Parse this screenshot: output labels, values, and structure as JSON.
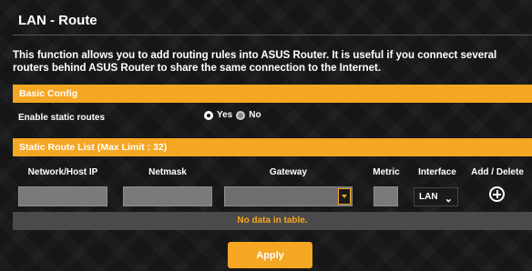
{
  "header": {
    "title": "LAN - Route",
    "description": "This function allows you to add routing rules into ASUS Router. It is useful if you connect several routers behind ASUS Router to share the same connection to the Internet."
  },
  "basic_config": {
    "section_title": "Basic Config",
    "static_routes_label": "Enable static routes",
    "yes_label": "Yes",
    "no_label": "No",
    "selected": "Yes"
  },
  "static_route_list": {
    "section_title": "Static Route List (Max Limit : 32)",
    "columns": [
      "Network/Host IP",
      "Netmask",
      "Gateway",
      "Metric",
      "Interface",
      "Add / Delete"
    ],
    "interface_value": "LAN",
    "empty_text": "No data in table."
  },
  "actions": {
    "apply_label": "Apply"
  },
  "colors": {
    "accent": "#f5a623",
    "background": "#141414"
  }
}
